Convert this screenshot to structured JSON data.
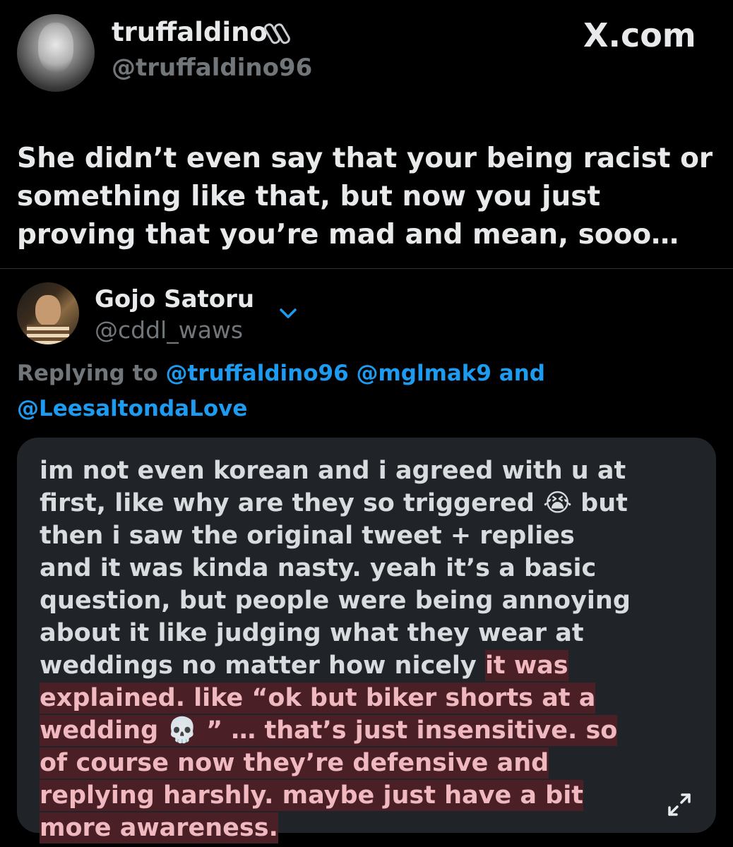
{
  "original_tweet": {
    "display_name": "truffaldino",
    "handle": "@truffaldino96",
    "text": "She didn’t even say that your being racist or something like that, but now you just proving that you’re mad and mean, sooo…",
    "source": "X.com"
  },
  "reply_tweet": {
    "display_name": "Gojo Satoru",
    "handle": "@cddl_waws",
    "replying_to_label": "Replying to",
    "mentions": [
      "@truffaldino96",
      "@mglmak9",
      "@LeesaltondaLove"
    ],
    "mentions_and": "and",
    "body": {
      "part1": "im not even korean and i agreed with u at first, like why are they so triggered ",
      "emoji_crying": "😭",
      "part2": " but then i saw the original tweet + replies and it was kinda nasty. yeah it’s a basic question, but people were being annoying about it like judging what they wear at weddings no matter how nicely ",
      "highlight1": "it was explained. like “ok but biker shorts at a wedding ",
      "emoji_skull": "💀",
      "highlight2": " ” … that’s just insensitive. so of course now they’re defensive and replying harshly. maybe just have a bit more awareness."
    }
  },
  "colors": {
    "background": "#000000",
    "card": "#202327",
    "link": "#1d9bf0",
    "muted": "#71767b",
    "highlight_bg": "#4a1f26",
    "highlight_text": "#f0b8bf"
  },
  "icons": [
    "verified-badge-icon",
    "chevron-down-icon",
    "expand-icon"
  ]
}
